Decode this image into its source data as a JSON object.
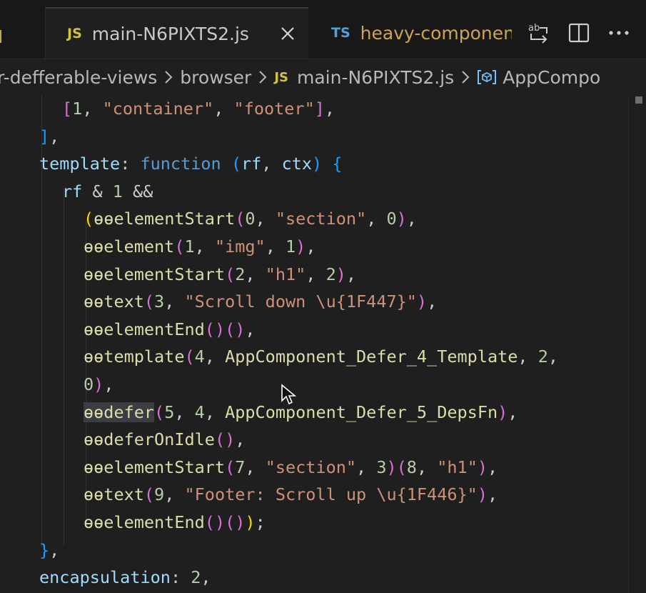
{
  "tabs": [
    {
      "badge": "",
      "label": "",
      "state": "partial"
    },
    {
      "badge": "JS",
      "label": "main-N6PIXTS2.js",
      "state": "active"
    },
    {
      "badge": "TS",
      "label": "heavy-component",
      "state": "inactive"
    }
  ],
  "tabbar_actions": [
    "compare-changes-icon",
    "split-editor-icon",
    "more-actions-icon"
  ],
  "breadcrumb": {
    "folder": "r-defferable-views",
    "subfolder": "browser",
    "file_badge": "JS",
    "file": "main-N6PIXTS2.js",
    "symbol": "AppCompo"
  },
  "colors": {
    "js_badge": "#d6c23c",
    "ts_badge": "#4ea3d8",
    "string": "#ce9178",
    "number": "#b5cea8",
    "keyword": "#569cd6",
    "function": "#dcdcaa",
    "bracket_1": "#ffd700",
    "bracket_2": "#da70d6",
    "bracket_3": "#179fff"
  },
  "code_lines": [
    {
      "indent": 2,
      "tokens": [
        [
          "b2",
          "["
        ],
        [
          "num",
          "1"
        ],
        [
          "pl",
          ", "
        ],
        [
          "str",
          "\"container\""
        ],
        [
          "pl",
          ", "
        ],
        [
          "str",
          "\"footer\""
        ],
        [
          "b2",
          "]"
        ],
        [
          "pl",
          ","
        ]
      ]
    },
    {
      "indent": 1,
      "tokens": [
        [
          "b3",
          "]"
        ],
        [
          "pl",
          ","
        ]
      ]
    },
    {
      "indent": 1,
      "tokens": [
        [
          "prop",
          "template"
        ],
        [
          "pl",
          ": "
        ],
        [
          "kw",
          "function"
        ],
        [
          "pl",
          " "
        ],
        [
          "b3",
          "("
        ],
        [
          "par",
          "rf"
        ],
        [
          "pl",
          ", "
        ],
        [
          "par",
          "ctx"
        ],
        [
          "b3",
          ")"
        ],
        [
          "pl",
          " "
        ],
        [
          "b3",
          "{"
        ]
      ]
    },
    {
      "indent": 2,
      "tokens": [
        [
          "par",
          "rf"
        ],
        [
          "pl",
          " & "
        ],
        [
          "num",
          "1"
        ],
        [
          "pl",
          " &&"
        ]
      ]
    },
    {
      "indent": 3,
      "tokens": [
        [
          "b1",
          "("
        ],
        [
          "fn",
          "ɵɵelementStart"
        ],
        [
          "b2",
          "("
        ],
        [
          "num",
          "0"
        ],
        [
          "pl",
          ", "
        ],
        [
          "str",
          "\"section\""
        ],
        [
          "pl",
          ", "
        ],
        [
          "num",
          "0"
        ],
        [
          "b2",
          ")"
        ],
        [
          "pl",
          ","
        ]
      ]
    },
    {
      "indent": 3,
      "tokens": [
        [
          "fn",
          "ɵɵelement"
        ],
        [
          "b2",
          "("
        ],
        [
          "num",
          "1"
        ],
        [
          "pl",
          ", "
        ],
        [
          "str",
          "\"img\""
        ],
        [
          "pl",
          ", "
        ],
        [
          "num",
          "1"
        ],
        [
          "b2",
          ")"
        ],
        [
          "pl",
          ","
        ]
      ]
    },
    {
      "indent": 3,
      "tokens": [
        [
          "fn",
          "ɵɵelementStart"
        ],
        [
          "b2",
          "("
        ],
        [
          "num",
          "2"
        ],
        [
          "pl",
          ", "
        ],
        [
          "str",
          "\"h1\""
        ],
        [
          "pl",
          ", "
        ],
        [
          "num",
          "2"
        ],
        [
          "b2",
          ")"
        ],
        [
          "pl",
          ","
        ]
      ]
    },
    {
      "indent": 3,
      "tokens": [
        [
          "fn",
          "ɵɵtext"
        ],
        [
          "b2",
          "("
        ],
        [
          "num",
          "3"
        ],
        [
          "pl",
          ", "
        ],
        [
          "str",
          "\"Scroll down \\u{1F447}\""
        ],
        [
          "b2",
          ")"
        ],
        [
          "pl",
          ","
        ]
      ]
    },
    {
      "indent": 3,
      "tokens": [
        [
          "fn",
          "ɵɵelementEnd"
        ],
        [
          "b2",
          "("
        ],
        [
          "b2",
          ")"
        ],
        [
          "b2",
          "("
        ],
        [
          "b2",
          ")"
        ],
        [
          "pl",
          ","
        ]
      ]
    },
    {
      "indent": 3,
      "tokens": [
        [
          "fn",
          "ɵɵtemplate"
        ],
        [
          "b2",
          "("
        ],
        [
          "num",
          "4"
        ],
        [
          "pl",
          ", "
        ],
        [
          "fn",
          "AppComponent_Defer_4_Template"
        ],
        [
          "pl",
          ", "
        ],
        [
          "num",
          "2"
        ],
        [
          "pl",
          ","
        ]
      ]
    },
    {
      "indent": 3,
      "tokens": [
        [
          "num",
          "0"
        ],
        [
          "b2",
          ")"
        ],
        [
          "pl",
          ","
        ]
      ]
    },
    {
      "indent": 3,
      "highlight": true,
      "tokens": [
        [
          "fnhl",
          "ɵɵdefer"
        ],
        [
          "b2",
          "("
        ],
        [
          "num",
          "5"
        ],
        [
          "pl",
          ", "
        ],
        [
          "num",
          "4"
        ],
        [
          "pl",
          ", "
        ],
        [
          "fn",
          "AppComponent_Defer_5_DepsFn"
        ],
        [
          "b2",
          ")"
        ],
        [
          "pl",
          ","
        ]
      ]
    },
    {
      "indent": 3,
      "tokens": [
        [
          "fn",
          "ɵɵdeferOnIdle"
        ],
        [
          "b2",
          "("
        ],
        [
          "b2",
          ")"
        ],
        [
          "pl",
          ","
        ]
      ]
    },
    {
      "indent": 3,
      "tokens": [
        [
          "fn",
          "ɵɵelementStart"
        ],
        [
          "b2",
          "("
        ],
        [
          "num",
          "7"
        ],
        [
          "pl",
          ", "
        ],
        [
          "str",
          "\"section\""
        ],
        [
          "pl",
          ", "
        ],
        [
          "num",
          "3"
        ],
        [
          "b2",
          ")"
        ],
        [
          "b2",
          "("
        ],
        [
          "num",
          "8"
        ],
        [
          "pl",
          ", "
        ],
        [
          "str",
          "\"h1\""
        ],
        [
          "b2",
          ")"
        ],
        [
          "pl",
          ","
        ]
      ]
    },
    {
      "indent": 3,
      "tokens": [
        [
          "fn",
          "ɵɵtext"
        ],
        [
          "b2",
          "("
        ],
        [
          "num",
          "9"
        ],
        [
          "pl",
          ", "
        ],
        [
          "str",
          "\"Footer: Scroll up \\u{1F446}\""
        ],
        [
          "b2",
          ")"
        ],
        [
          "pl",
          ","
        ]
      ]
    },
    {
      "indent": 3,
      "tokens": [
        [
          "fn",
          "ɵɵelementEnd"
        ],
        [
          "b2",
          "("
        ],
        [
          "b2",
          ")"
        ],
        [
          "b2",
          "("
        ],
        [
          "b2",
          ")"
        ],
        [
          "b1",
          ")"
        ],
        [
          "pl",
          ";"
        ]
      ]
    },
    {
      "indent": 1,
      "tokens": [
        [
          "b3",
          "}"
        ],
        [
          "pl",
          ","
        ]
      ]
    },
    {
      "indent": 1,
      "tokens": [
        [
          "prop",
          "encapsulation"
        ],
        [
          "pl",
          ": "
        ],
        [
          "num",
          "2"
        ],
        [
          "pl",
          ","
        ]
      ]
    }
  ]
}
